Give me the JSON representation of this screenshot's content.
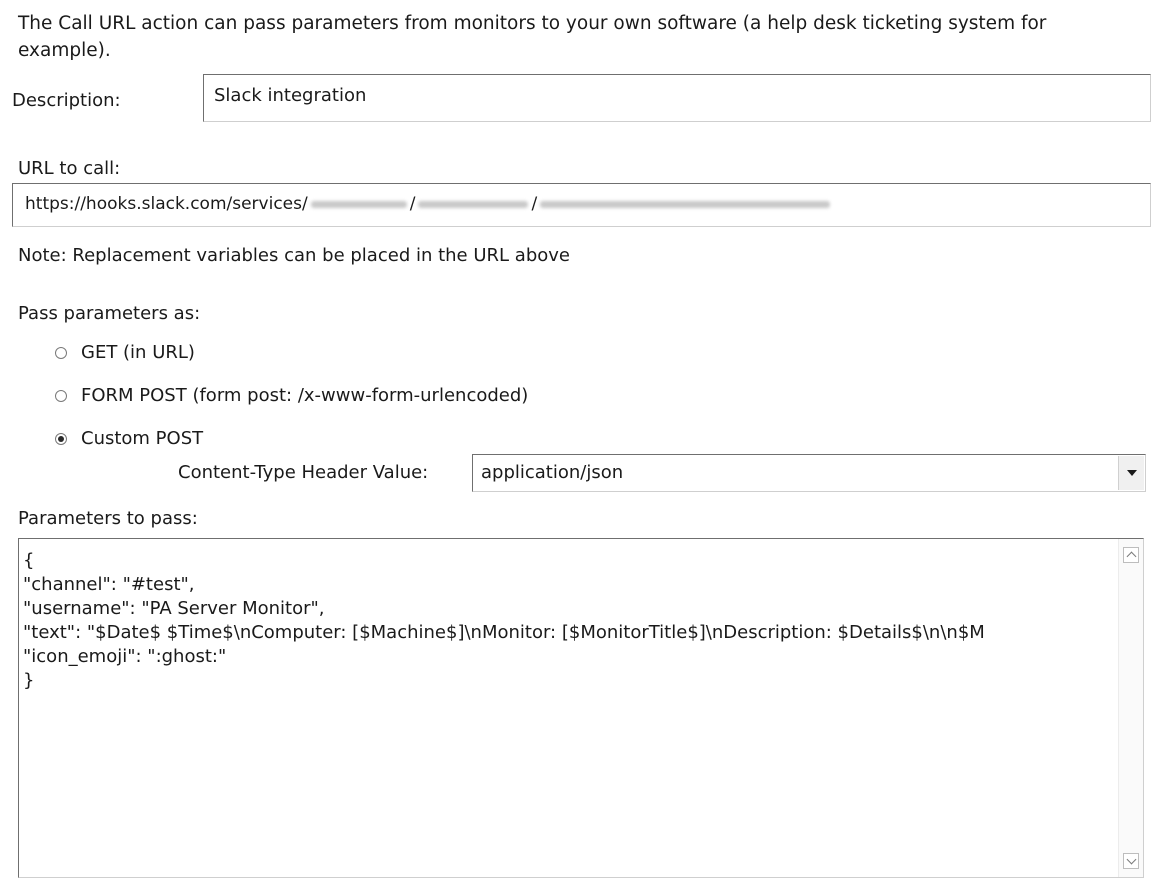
{
  "intro_text": "The Call URL action can pass parameters from monitors to your own software (a help desk ticketing system for example).",
  "description": {
    "label": "Description:",
    "value": "Slack integration"
  },
  "url": {
    "label": "URL to call:",
    "value_prefix": "https://hooks.slack.com/services/",
    "separator": "/",
    "note": "Note: Replacement variables can be placed in the URL above"
  },
  "pass_params": {
    "label": "Pass parameters as:",
    "options": [
      {
        "label": "GET (in URL)",
        "checked": false
      },
      {
        "label": "FORM POST (form post: /x-www-form-urlencoded)",
        "checked": false
      },
      {
        "label": "Custom POST",
        "checked": true
      }
    ]
  },
  "content_type": {
    "label": "Content-Type Header Value:",
    "value": "application/json"
  },
  "parameters": {
    "label": "Parameters to pass:",
    "lines": [
      "{",
      "\"channel\": \"#test\",",
      "\"username\": \"PA Server Monitor\",",
      "\"text\": \"$Date$  $Time$\\nComputer: [$Machine$]\\nMonitor: [$MonitorTitle$]\\nDescription: $Details$\\n\\n$M",
      "\"icon_emoji\": \":ghost:\"",
      "}"
    ]
  },
  "icons": {
    "radio": "radio-button-icon",
    "dropdown": "chevron-down-icon",
    "scroll_up": "scroll-up-icon",
    "scroll_down": "scroll-down-icon"
  }
}
